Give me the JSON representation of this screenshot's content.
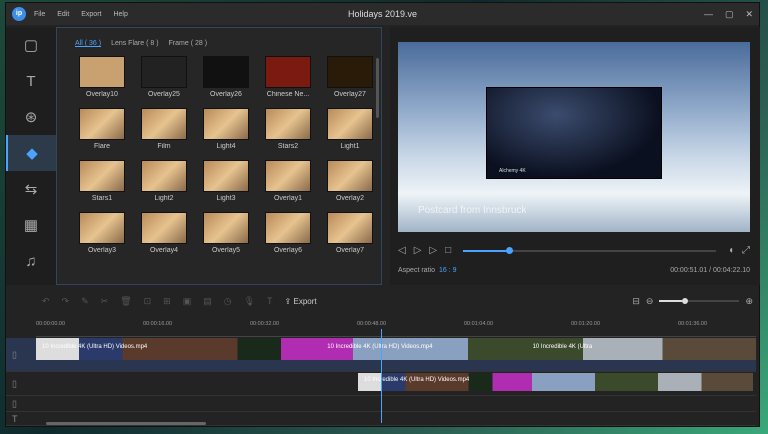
{
  "app": {
    "title": "Holidays 2019.ve",
    "logo": "ip",
    "menu": [
      "File",
      "Edit",
      "Export",
      "Help"
    ]
  },
  "window_controls": [
    "minimize-icon",
    "maximize-icon",
    "close-icon"
  ],
  "sidebar": [
    {
      "icon": "media-icon",
      "glyph": "▢"
    },
    {
      "icon": "text-icon",
      "glyph": "T"
    },
    {
      "icon": "filter-icon",
      "glyph": "⊛"
    },
    {
      "icon": "overlay-icon",
      "glyph": "◆",
      "active": true
    },
    {
      "icon": "transition-icon",
      "glyph": "⇆"
    },
    {
      "icon": "film-icon",
      "glyph": "▦"
    },
    {
      "icon": "music-icon",
      "glyph": "♫"
    }
  ],
  "library": {
    "tabs": [
      "All ( 36 )",
      "Lens Flare ( 8 )",
      "Frame ( 28 )"
    ],
    "items": [
      "Overlay10",
      "Overlay25",
      "Overlay26",
      "Chinese Ne...",
      "Overlay27",
      "Flare",
      "Film",
      "Light4",
      "Stars2",
      "Light1",
      "Stars1",
      "Light2",
      "Light3",
      "Overlay1",
      "Overlay2",
      "Overlay3",
      "Overlay4",
      "Overlay5",
      "Overlay6",
      "Overlay7"
    ]
  },
  "preview": {
    "watermark": "Postcard from Innsbruck",
    "pip_label": "Alchemy 4K",
    "progress": 0.17,
    "aspect_label": "Aspect ratio",
    "aspect_value": "16 : 9",
    "time": "00:00:51.01 / 00:04:22.10"
  },
  "toolbar": {
    "export_label": "Export",
    "zoom_level": 0.28
  },
  "timeline": {
    "ruler": [
      "00:00:00.00",
      "00:00:16.00",
      "00:00:32.00",
      "00:00:48.00",
      "00:01:04.00",
      "00:01:20.00",
      "00:01:36.00"
    ],
    "clips": [
      {
        "track": 1,
        "label": "10 Incredible 4K (Ultra HD) Videos.mp4"
      },
      {
        "track": 1,
        "label": "10 Incredible 4K (Ultra HD) Videos.mp4"
      },
      {
        "track": 1,
        "label": "10 Incredible 4K (Ultra"
      },
      {
        "track": 2,
        "label": "10 Incredible 4K (Ultra HD) Videos.mp4"
      }
    ]
  },
  "colors": {
    "accent": "#4aa3ff",
    "bg": "#232323"
  }
}
